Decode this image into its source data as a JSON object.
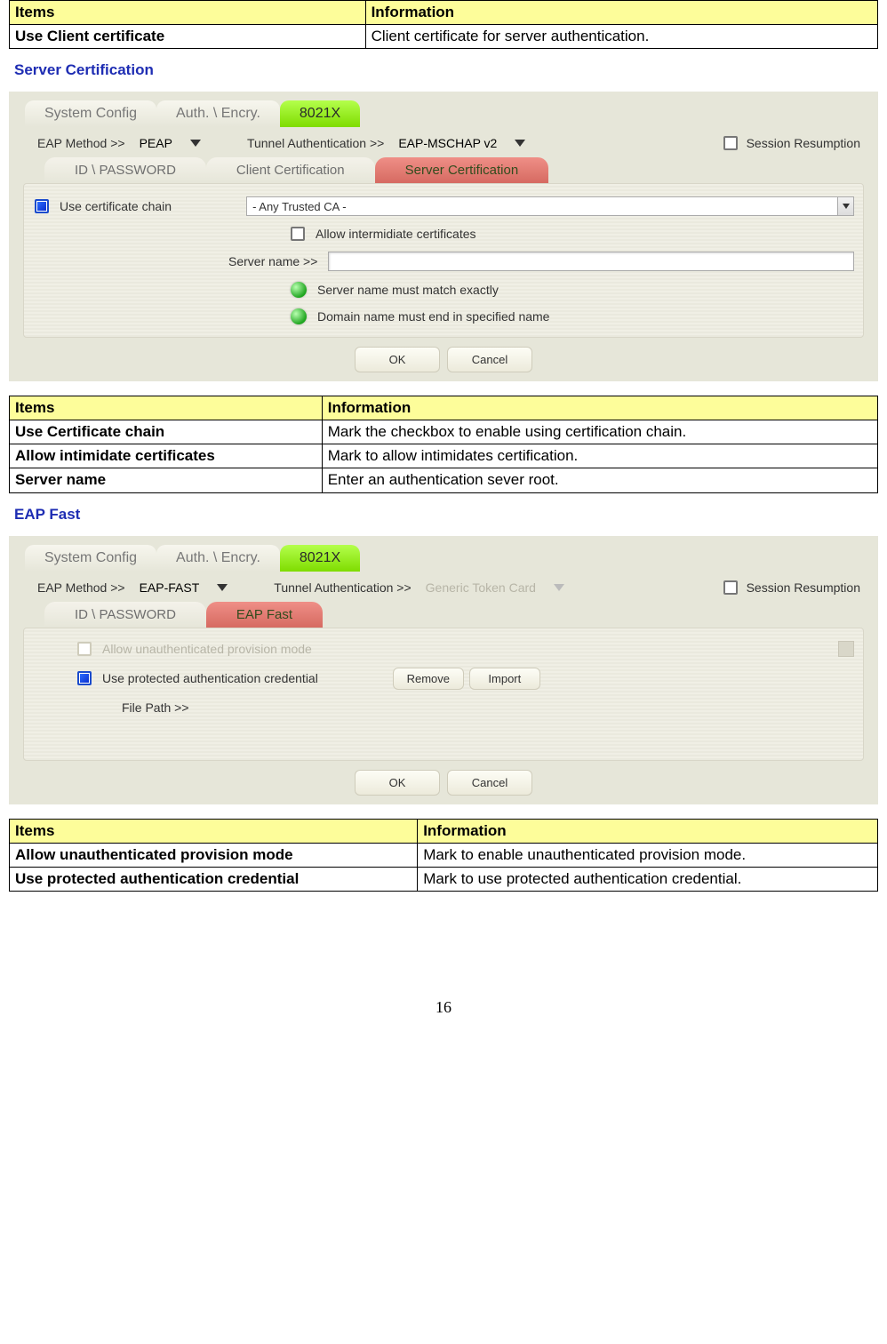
{
  "table1": {
    "head_items": "Items",
    "head_info": "Information",
    "row1_key": "Use Client certificate",
    "row1_val": "Client certificate for server authentication."
  },
  "heading_server_cert": "Server Certification",
  "shot1": {
    "tabs": {
      "sys": "System Config",
      "auth": "Auth. \\ Encry.",
      "x": "8021X"
    },
    "eap_method_label": "EAP Method >>",
    "eap_method_value": "PEAP",
    "tunnel_label": "Tunnel Authentication >>",
    "tunnel_value": "EAP-MSCHAP v2",
    "session_label": "Session Resumption",
    "subtabs": {
      "idpw": "ID \\ PASSWORD",
      "client": "Client Certification",
      "server": "Server Certification"
    },
    "use_chain_label": "Use certificate chain",
    "ca_value": "- Any Trusted CA -",
    "allow_inter_label": "Allow intermidiate certificates",
    "server_name_label": "Server name >>",
    "match_exact": "Server name must match exactly",
    "domain_end": "Domain name must end in specified name",
    "ok": "OK",
    "cancel": "Cancel"
  },
  "table2": {
    "head_items": "Items",
    "head_info": "Information",
    "r1k": "Use Certificate chain",
    "r1v": "Mark the checkbox to enable using certification chain.",
    "r2k": "Allow intimidate certificates",
    "r2v": "Mark to allow intimidates certification.",
    "r3k": "Server name",
    "r3v": "Enter an authentication sever root."
  },
  "heading_eap_fast": "EAP Fast",
  "shot2": {
    "tabs": {
      "sys": "System Config",
      "auth": "Auth. \\ Encry.",
      "x": "8021X"
    },
    "eap_method_label": "EAP Method >>",
    "eap_method_value": "EAP-FAST",
    "tunnel_label": "Tunnel Authentication >>",
    "tunnel_value": "Generic Token Card",
    "session_label": "Session Resumption",
    "subtabs": {
      "idpw": "ID \\ PASSWORD",
      "fast": "EAP Fast"
    },
    "allow_unauth_label": "Allow unauthenticated provision mode",
    "use_protected_label": "Use protected authentication credential",
    "remove": "Remove",
    "import": "Import",
    "file_path_label": "File Path >>",
    "ok": "OK",
    "cancel": "Cancel"
  },
  "table3": {
    "head_items": "Items",
    "head_info": "Information",
    "r1k": "Allow unauthenticated provision mode",
    "r1v": "Mark to enable unauthenticated provision mode.",
    "r2k": "Use protected authentication credential",
    "r2v": "Mark to use protected authentication credential."
  },
  "page_number": "16"
}
